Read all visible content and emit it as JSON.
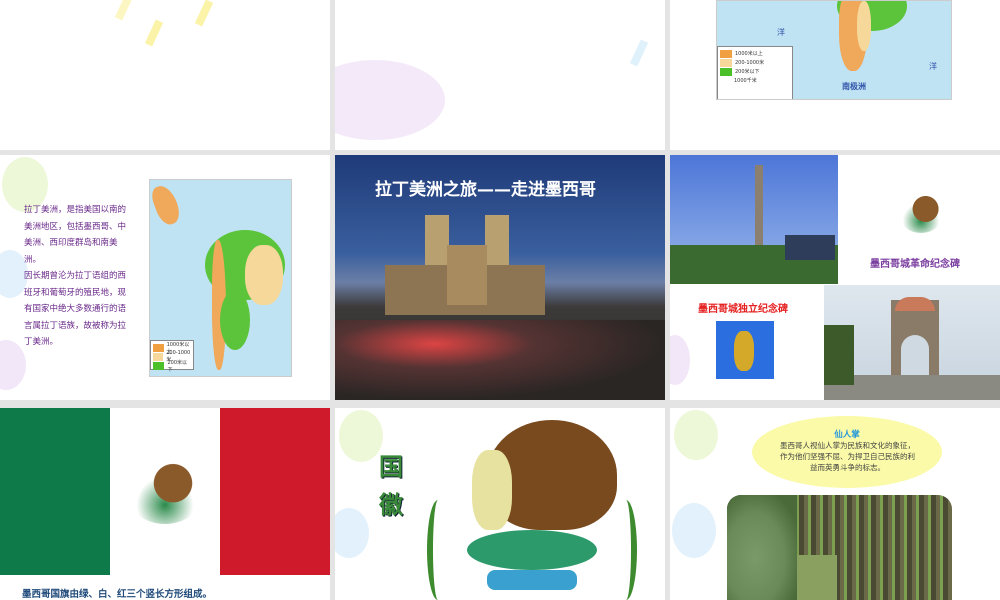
{
  "slides": {
    "top_map_legend": [
      "1000米以上",
      "200-1000米",
      "200米以下",
      "1000千米"
    ],
    "top_map_labels": {
      "ocean": "洋",
      "antarctica": "南极洲"
    },
    "latin_america": {
      "paragraph1": "拉丁美洲，是指美国以南的美洲地区，包括墨西哥、中美洲、西印度群岛和南美洲。",
      "paragraph2": "因长期曾沦为拉丁语组的西班牙和葡萄牙的殖民地，现有国家中绝大多数通行的语言属拉丁语族，故被称为拉丁美洲。",
      "legend": [
        "1000米以上",
        "200-1000米",
        "200米以下"
      ]
    },
    "title_slide": {
      "title": "拉丁美洲之旅——走进墨西哥"
    },
    "monuments": {
      "revolution_caption": "墨西哥城革命纪念碑",
      "independence_caption": "墨西哥城独立纪念碑"
    },
    "flag": {
      "caption": "墨西哥国旗由绿、白、红三个竖长方形组成。",
      "colors": [
        "#006847",
        "#ffffff",
        "#ce1126"
      ]
    },
    "emblem": {
      "title": "国徽"
    },
    "cactus": {
      "title": "仙人掌",
      "text": "墨西哥人视仙人掌为民族和文化的象征，作为他们坚强不屈、为捍卫自己民族的利益而英勇斗争的标志。"
    }
  }
}
